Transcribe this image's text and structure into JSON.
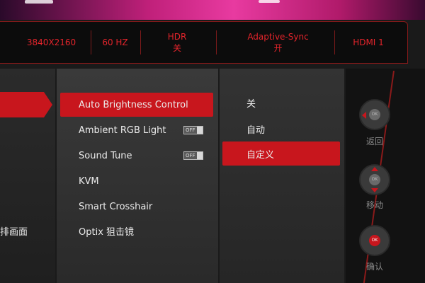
{
  "status": {
    "resolution": "3840X2160",
    "refresh": "60 HZ",
    "hdr_label": "HDR",
    "hdr_value": "关",
    "sync_label": "Adaptive-Sync",
    "sync_value": "开",
    "input": "HDMI 1"
  },
  "left": {
    "label": "排画面"
  },
  "menu": {
    "items": [
      {
        "label": "Auto Brightness Control"
      },
      {
        "label": "Ambient RGB Light",
        "toggle": "OFF"
      },
      {
        "label": "Sound Tune",
        "toggle": "OFF"
      },
      {
        "label": "KVM"
      },
      {
        "label": "Smart Crosshair"
      },
      {
        "label": "Optix 狙击镜"
      }
    ]
  },
  "options": {
    "items": [
      {
        "label": "关"
      },
      {
        "label": "自动"
      },
      {
        "label": "自定义"
      }
    ]
  },
  "nav": {
    "back_label": "返回",
    "move_label": "移动",
    "confirm_label": "确认",
    "ok": "OK"
  },
  "colors": {
    "accent": "#c8161d",
    "status_text": "#e3242b"
  }
}
